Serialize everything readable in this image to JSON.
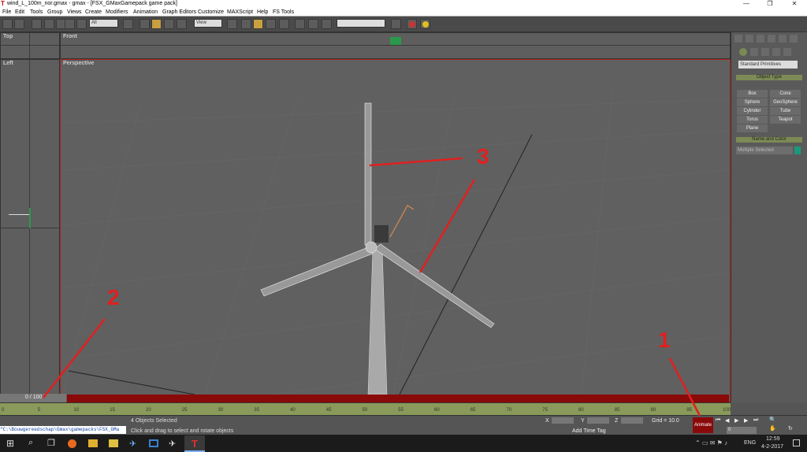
{
  "window": {
    "title": "wind_L_100m_nor.gmax - gmax - [FSX_GMaxGamepack game pack]",
    "btn_min": "—",
    "btn_max": "❐",
    "btn_close": "✕"
  },
  "menu": [
    "File",
    "Edit",
    "Tools",
    "Group",
    "Views",
    "Create",
    "Modifiers",
    "Animation",
    "Graph Editors",
    "Customize",
    "MAXScript",
    "Help",
    "FS Tools"
  ],
  "toolbar": {
    "selection_filter": "All",
    "coord_system": "View"
  },
  "viewports": {
    "top": "Top",
    "front": "Front",
    "left": "Left",
    "perspective": "Perspective"
  },
  "command_panel": {
    "dropdown": "Standard Primitives",
    "object_type_header": "Object Type",
    "buttons": [
      "Box",
      "Cone",
      "Sphere",
      "GeoSphere",
      "Cylinder",
      "Tube",
      "Torus",
      "Teapot",
      "Plane"
    ],
    "name_color_header": "Name and Color",
    "name_field": "Multiple Selected",
    "color_swatch": "#1a9a7a"
  },
  "timeline": {
    "frame_counter": "0 / 100",
    "ticks": [
      "0",
      "5",
      "10",
      "15",
      "20",
      "25",
      "30",
      "35",
      "40",
      "45",
      "50",
      "55",
      "60",
      "65",
      "70",
      "75",
      "80",
      "85",
      "90",
      "95",
      "100"
    ]
  },
  "status": {
    "path": "\"C:\\Bouwgereedschap\\Gmax\\gamepacks\\FSX_GMa",
    "objects_selected": "4 Objects Selected",
    "prompt": "Click and drag to select and rotate objects",
    "x_label": "X",
    "y_label": "Y",
    "z_label": "Z",
    "grid": "Grid = 10.0",
    "add_time_tag": "Add Time Tag",
    "animate": "Animate",
    "current_frame": "0"
  },
  "annotations": {
    "a1": "1",
    "a2": "2",
    "a3": "3"
  },
  "taskbar": {
    "time": "12:59",
    "date": "4-2-2017",
    "lang": "ENG"
  }
}
